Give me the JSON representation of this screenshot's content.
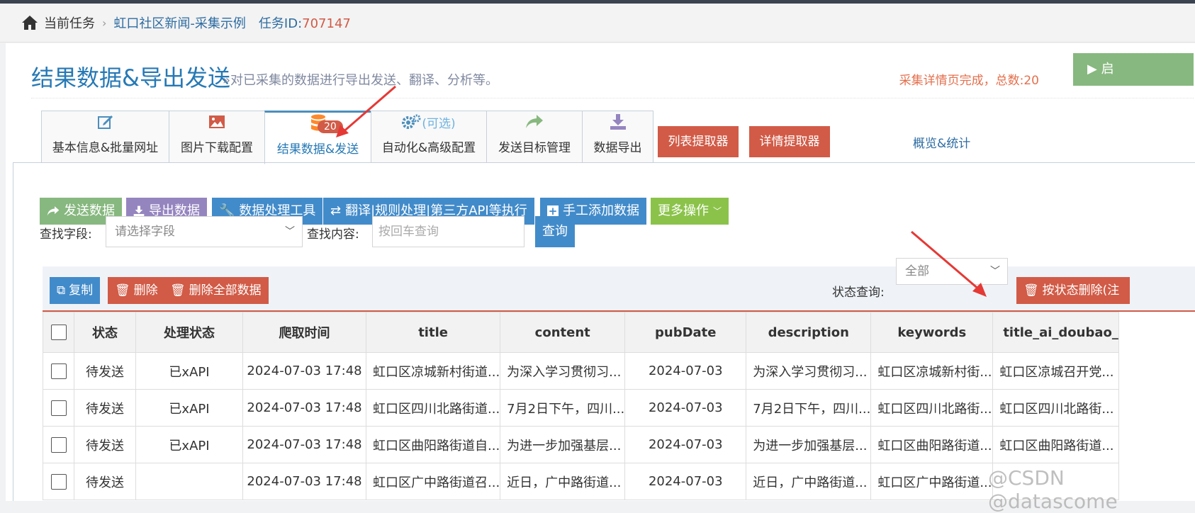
{
  "breadcrumb": {
    "current_task": "当前任务",
    "task_name": "虹口社区新闻-采集示例",
    "task_id_label": "任务ID:",
    "task_id": "707147"
  },
  "header": {
    "title": "结果数据&导出发送",
    "subtitle": "»对已采集的数据进行导出发送、翻译、分析等。",
    "status": "采集详情页完成，总数:20",
    "start_button": "启"
  },
  "tabs": [
    {
      "label": "基本信息&批量网址",
      "icon": "edit-icon"
    },
    {
      "label": "图片下载配置",
      "icon": "image-icon"
    },
    {
      "label": "结果数据&发送",
      "icon": "database-icon",
      "badge": "20",
      "active": true
    },
    {
      "label": "自动化&高级配置",
      "icon": "gears-icon",
      "icon_text": "(可选)"
    },
    {
      "label": "发送目标管理",
      "icon": "share-icon"
    },
    {
      "label": "数据导出",
      "icon": "download-icon"
    }
  ],
  "extractor_buttons": {
    "list": "列表提取器",
    "detail": "详情提取器",
    "overview": "概览&统计"
  },
  "actions": {
    "send": "发送数据",
    "export": "导出数据",
    "process": "数据处理工具",
    "translate": "翻译|规则处理|第三方API等执行",
    "add": "手工添加数据",
    "more": "更多操作"
  },
  "search": {
    "field_label": "查找字段:",
    "field_placeholder": "请选择字段",
    "content_label": "查找内容:",
    "content_placeholder": "按回车查询",
    "query_button": "查询"
  },
  "toolbar": {
    "copy": "复制",
    "delete": "删除",
    "delete_all": "删除全部数据",
    "status_label": "状态查询:",
    "status_value": "全部",
    "delete_by_status": "按状态删除(注"
  },
  "table": {
    "columns": [
      "状态",
      "处理状态",
      "爬取时间",
      "title",
      "content",
      "pubDate",
      "description",
      "keywords",
      "title_ai_doubao_"
    ],
    "rows": [
      [
        "待发送",
        "已xAPI",
        "2024-07-03 17:48",
        "虹口区凉城新村街道...",
        "为深入学习贯彻习...",
        "2024-07-03",
        "为深入学习贯彻习...",
        "虹口区凉城新村街...",
        "虹口区凉城召开党..."
      ],
      [
        "待发送",
        "已xAPI",
        "2024-07-03 17:48",
        "虹口区四川北路街道...",
        "7月2日下午，四川...",
        "2024-07-03",
        "7月2日下午，四川...",
        "虹口区四川北路街...",
        "虹口区四川北路街..."
      ],
      [
        "待发送",
        "已xAPI",
        "2024-07-03 17:48",
        "虹口区曲阳路街道自...",
        "为进一步加强基层...",
        "2024-07-03",
        "为进一步加强基层...",
        "虹口区曲阳路街道...",
        "虹口区曲阳路街道..."
      ],
      [
        "待发送",
        "",
        "2024-07-03 17:48",
        "虹口区广中路街道召...",
        "近日，广中路街道...",
        "2024-07-03",
        "近日，广中路街道...",
        "虹口区广中路街道...",
        ""
      ]
    ]
  },
  "watermark": "@CSDN @datascome"
}
